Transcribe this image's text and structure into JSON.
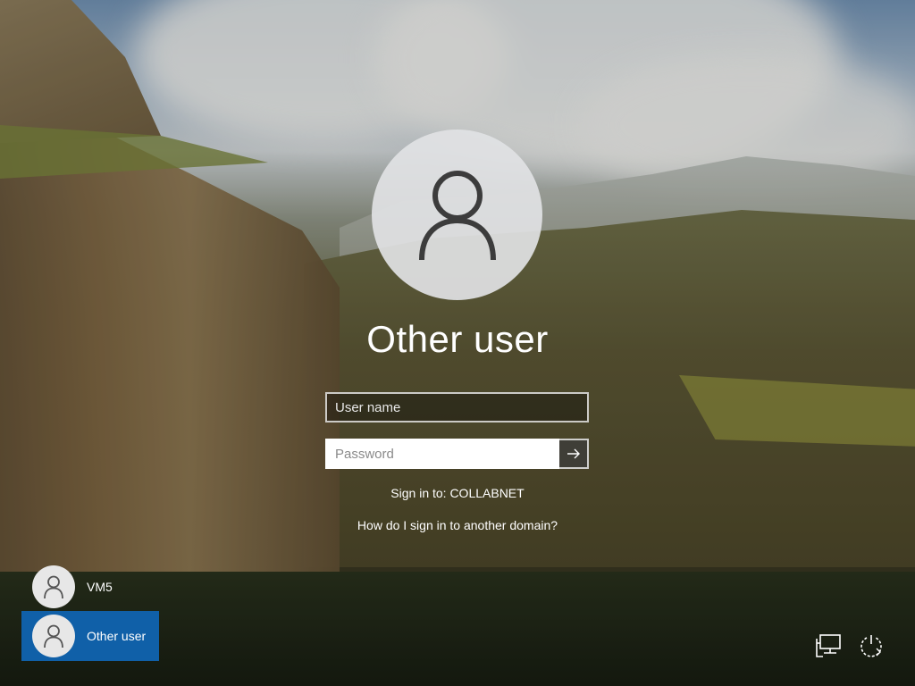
{
  "login": {
    "title": "Other user",
    "username_placeholder": "User name",
    "password_placeholder": "Password",
    "sign_in_to": "Sign in to: COLLABNET",
    "domain_link": "How do I sign in to another domain?"
  },
  "users": [
    {
      "label": "VM5",
      "selected": false
    },
    {
      "label": "Other user",
      "selected": true
    }
  ],
  "colors": {
    "selected_user_bg": "#1060a8",
    "avatar_bg": "#e1e2e4"
  },
  "icons": {
    "submit": "arrow-right-icon",
    "network": "network-icon",
    "power": "power-icon",
    "user": "user-icon"
  }
}
